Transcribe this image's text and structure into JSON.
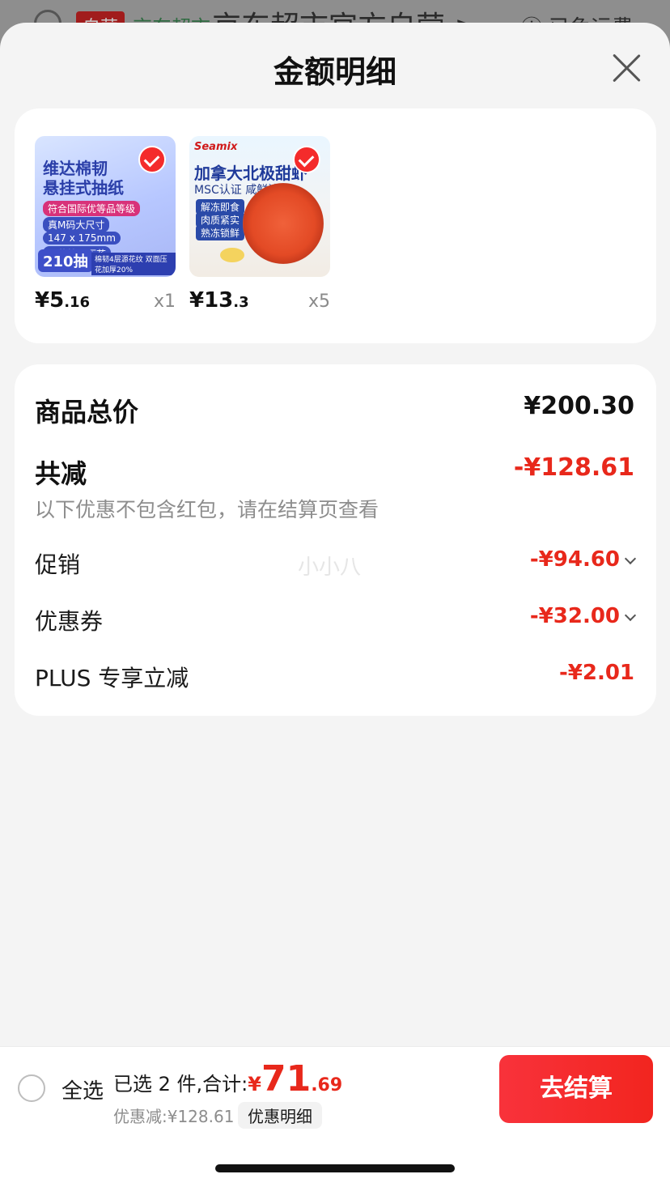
{
  "background": {
    "badge": "自营",
    "tag": "京东超市",
    "store_title": "京东超市官方自营",
    "arrow": ">",
    "shipping_info": "已免运费"
  },
  "sheet": {
    "title": "金额明细",
    "close_icon": "close-icon"
  },
  "products": [
    {
      "image_text": {
        "headline_1": "维达棉韧",
        "headline_2": "悬挂式抽纸",
        "standard": "符合国际优等品等级",
        "feature_1": "真M码大尺寸",
        "feature_2": "147 x 175mm",
        "feature_3": "源花棉柔压花",
        "count": "210抽",
        "bottom_text": "棉韧4层源花纹 双面压花加厚20%"
      },
      "price_int": "¥5",
      "price_dec": ".16",
      "qty": "x1",
      "selected": true
    },
    {
      "image_text": {
        "brand": "Seamix",
        "headline": "加拿大北极甜虾",
        "sub": "MSC认证 咸鲜清甜",
        "pill_1": "解冻即食",
        "pill_2": "肉质紧实",
        "pill_3": "熟冻锁鲜"
      },
      "price_int": "¥13",
      "price_dec": ".3",
      "qty": "x5",
      "selected": true
    }
  ],
  "summary": {
    "total_label": "商品总价",
    "total_value": "¥200.30",
    "reduce_label": "共减",
    "reduce_value": "-¥128.61",
    "note": "以下优惠不包含红包，请在结算页查看",
    "promo_label": "促销",
    "promo_value": "-¥94.60",
    "coupon_label": "优惠券",
    "coupon_value": "-¥32.00",
    "plus_label": "PLUS 专享立减",
    "plus_value": "-¥2.01",
    "watermark": "小小八"
  },
  "bottom_bar": {
    "select_all": "全选",
    "selected_text": "已选 2 件,合计:",
    "yen": "¥",
    "amount_int": "71",
    "amount_dec": ".69",
    "discount_text": "优惠减:¥128.61",
    "detail_chip": "优惠明细",
    "checkout": "去结算"
  },
  "colors": {
    "accent_red": "#e8281b",
    "checkout_red": "#f42b2b",
    "sheet_bg": "#f4f4f4"
  }
}
